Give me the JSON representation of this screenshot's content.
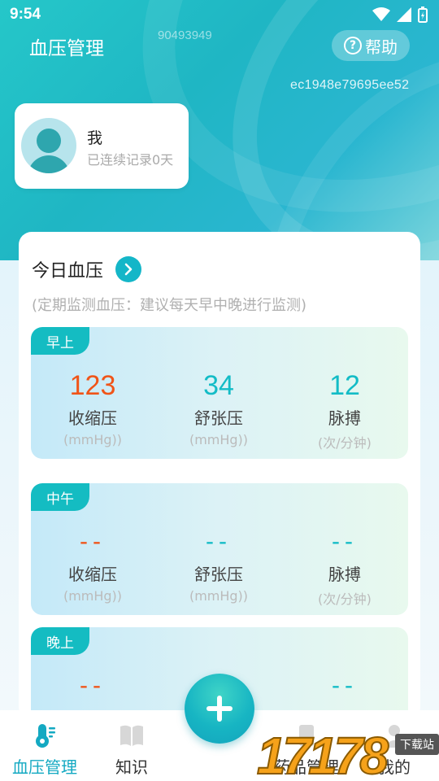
{
  "status_bar": {
    "time": "9:54"
  },
  "header": {
    "title": "血压管理",
    "watermark_top": "90493949",
    "help_label": "帮助",
    "watermark_id": "ec1948e79695ee52"
  },
  "profile": {
    "name": "我",
    "streak_text": "已连续记录0天"
  },
  "today": {
    "title": "今日血压",
    "hint": "(定期监测血压：建议每天早中晚进行监测)"
  },
  "periods": [
    {
      "label": "早上",
      "systolic": "123",
      "diastolic": "34",
      "pulse": "12"
    },
    {
      "label": "中午",
      "systolic": "--",
      "diastolic": "--",
      "pulse": "--"
    },
    {
      "label": "晚上",
      "systolic": "--",
      "diastolic": "--",
      "pulse": "--"
    }
  ],
  "metric_labels": {
    "systolic": "收缩压",
    "diastolic": "舒张压",
    "pulse": "脉搏",
    "unit_pressure": "(mmHg))",
    "unit_pulse": "(次/分钟)"
  },
  "tabs": [
    {
      "label": "血压管理",
      "icon": "thermometer-icon",
      "active": true
    },
    {
      "label": "知识",
      "icon": "book-icon",
      "active": false
    },
    {
      "label": "药品管理",
      "icon": "list-icon",
      "active": false
    },
    {
      "label": "我的",
      "icon": "person-icon",
      "active": false
    }
  ],
  "brand": {
    "digits": "17178",
    "badge": "下载站"
  },
  "colors": {
    "accent": "#14b6c8",
    "systolic_value": "#f05418",
    "teal_value": "#13bcc6"
  }
}
